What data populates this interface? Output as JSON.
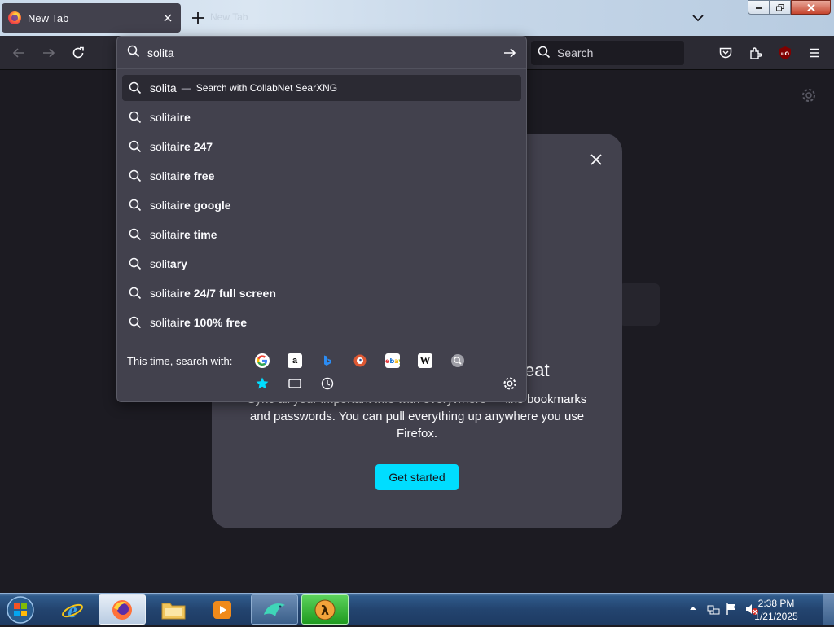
{
  "tab": {
    "title": "New Tab",
    "ghost_title": "New Tab"
  },
  "urlbar": {
    "typed": "solita",
    "first_result": {
      "text": "solita",
      "dash": "—",
      "action": "Search with CollabNet SearXNG"
    },
    "suggestions": [
      {
        "typed": "solita",
        "completion": "ire"
      },
      {
        "typed": "solita",
        "completion": "ire 247"
      },
      {
        "typed": "solita",
        "completion": "ire free"
      },
      {
        "typed": "solita",
        "completion": "ire google"
      },
      {
        "typed": "solita",
        "completion": "ire time"
      },
      {
        "typed": "solit",
        "completion": "ary"
      },
      {
        "typed": "solita",
        "completion": "ire 24/7 full screen"
      },
      {
        "typed": "solita",
        "completion": "ire 100% free"
      }
    ],
    "oneoff_label": "This time, search with:",
    "engines": [
      "Google",
      "Amazon.com",
      "Bing",
      "DuckDuckGo",
      "eBay",
      "Wikipedia",
      "Search engine"
    ],
    "modes": [
      "bookmarks-icon",
      "tabs-icon",
      "history-icon"
    ]
  },
  "toolbar": {
    "search_placeholder": "Search"
  },
  "card": {
    "heading_tail": "eat",
    "body": "Sync all your important info with everywhere — like bookmarks and passwords. You can pull everything up anywhere you use Firefox.",
    "button": "Get started"
  },
  "taskbar": {
    "time": "2:38 PM",
    "date": "1/21/2025"
  },
  "colors": {
    "accent": "#00ddff",
    "panel": "#42414d",
    "toolbar": "#2b2a33",
    "page": "#1c1b22"
  }
}
